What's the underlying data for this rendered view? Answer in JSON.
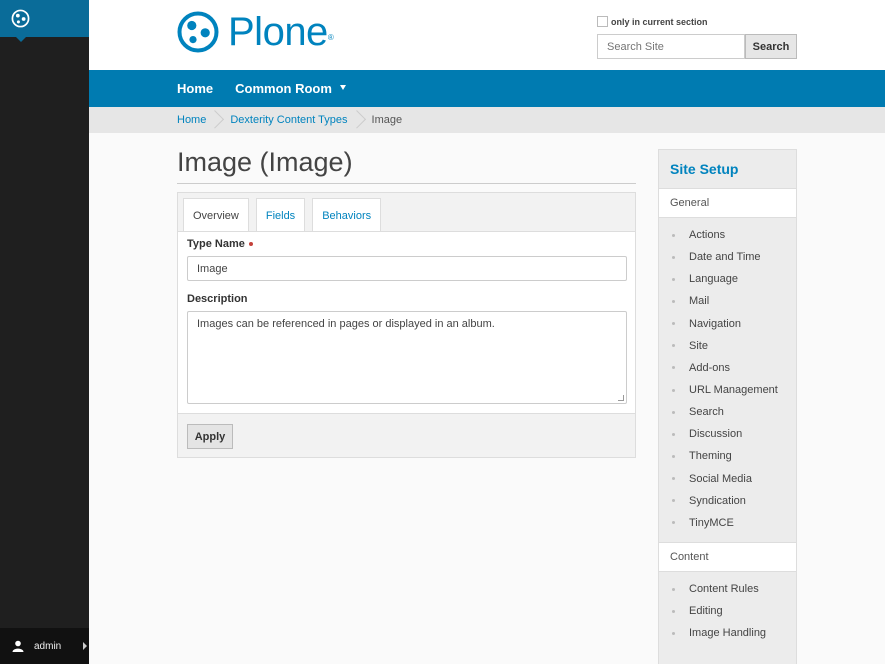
{
  "toolbar": {
    "user": "admin"
  },
  "header": {
    "logo_text": "Plone",
    "logo_mark": "®",
    "search": {
      "only_current": "only in current section",
      "placeholder": "Search Site",
      "button": "Search"
    }
  },
  "nav": {
    "items": [
      "Home",
      "Common Room"
    ]
  },
  "breadcrumb": {
    "items": [
      "Home",
      "Dexterity Content Types"
    ],
    "current": "Image"
  },
  "main": {
    "title": "Image (Image)",
    "tabs": [
      "Overview",
      "Fields",
      "Behaviors"
    ],
    "type_name_label": "Type Name",
    "type_name_value": "Image",
    "description_label": "Description",
    "description_value": "Images can be referenced in pages or displayed in an album.",
    "apply": "Apply"
  },
  "sidebar": {
    "title": "Site Setup",
    "general": "General",
    "general_items": [
      "Actions",
      "Date and Time",
      "Language",
      "Mail",
      "Navigation",
      "Site",
      "Add-ons",
      "URL Management",
      "Search",
      "Discussion",
      "Theming",
      "Social Media",
      "Syndication",
      "TinyMCE"
    ],
    "content": "Content",
    "content_items": [
      "Content Rules",
      "Editing",
      "Image Handling"
    ]
  },
  "colors": {
    "brand": "#0083be",
    "nav": "#007bb1",
    "toolbar": "#1f1f1f"
  }
}
